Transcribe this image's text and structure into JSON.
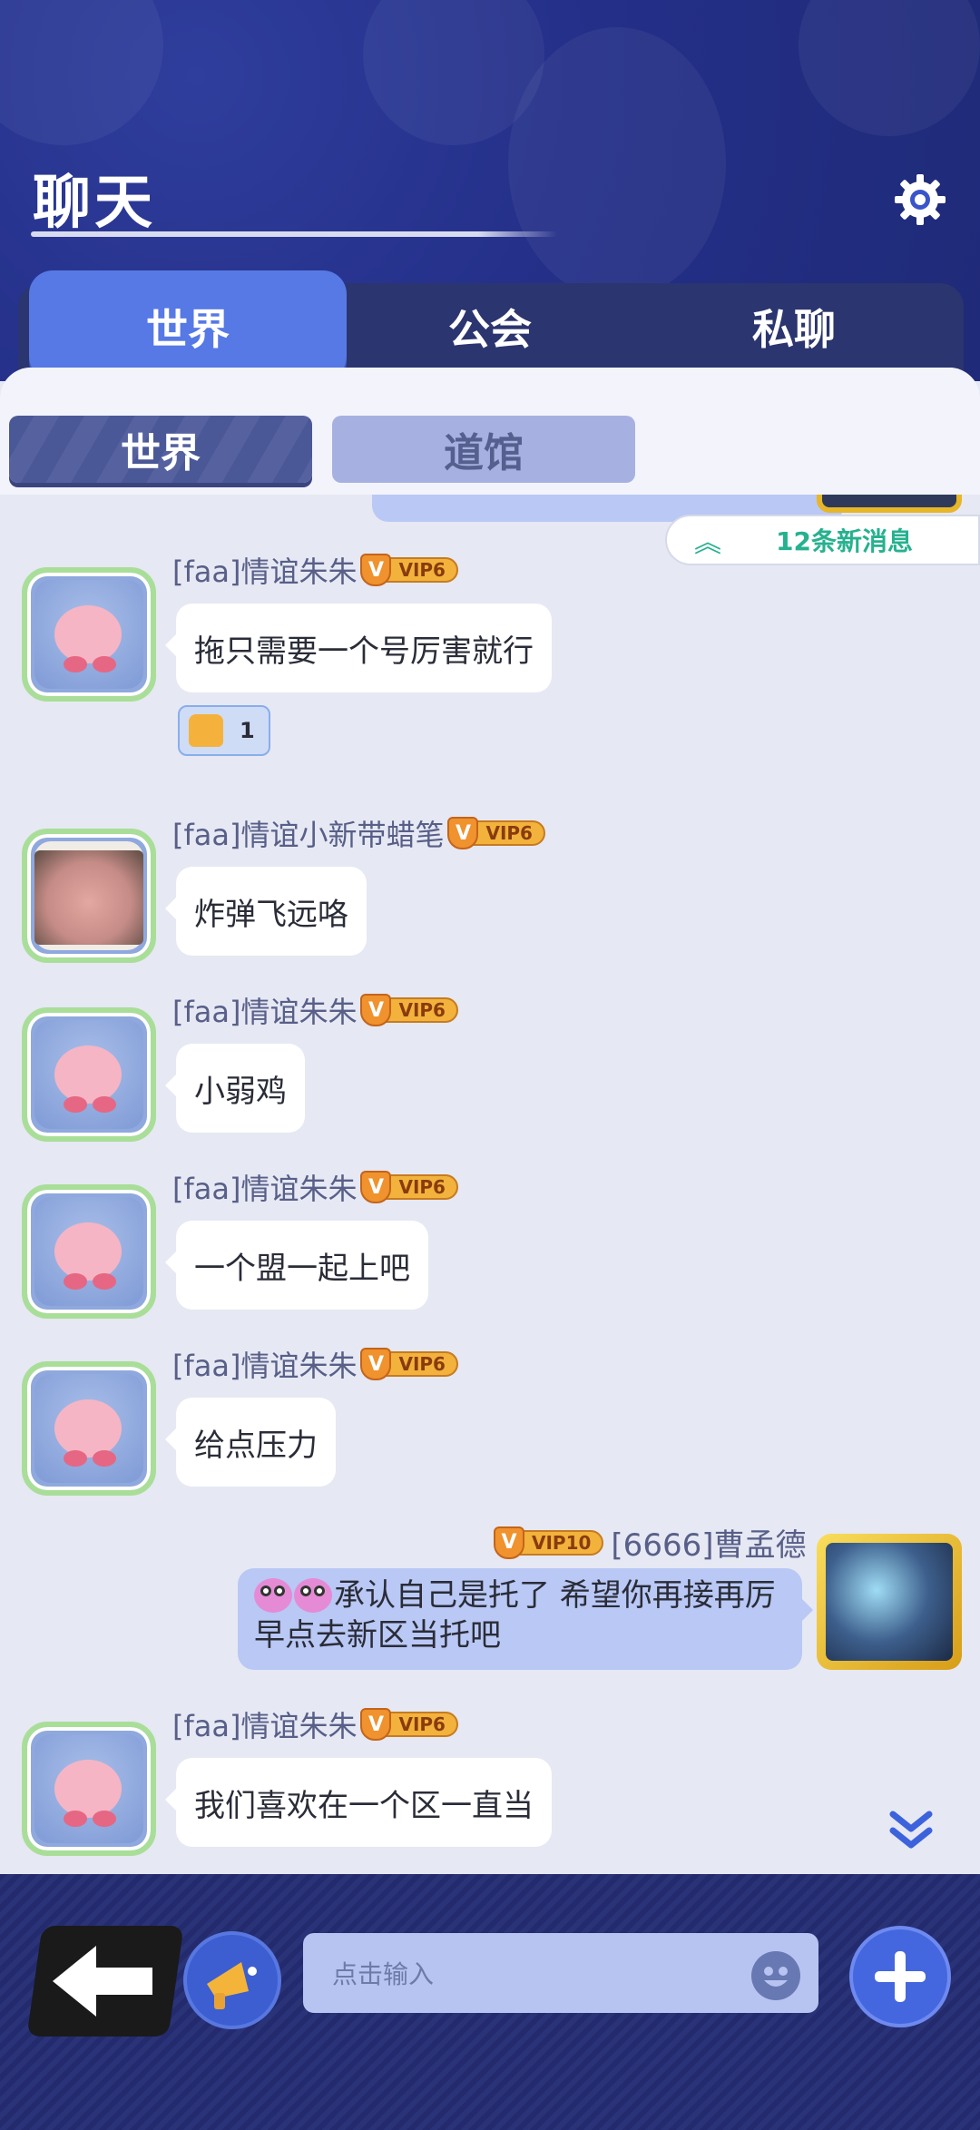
{
  "header": {
    "title": "聊天"
  },
  "tabs": [
    {
      "label": "世界",
      "active": true
    },
    {
      "label": "公会",
      "active": false
    },
    {
      "label": "私聊",
      "active": false
    }
  ],
  "subtabs": [
    {
      "label": "世界",
      "active": true
    },
    {
      "label": "道馆",
      "active": false
    }
  ],
  "new_messages": {
    "label": "12条新消息"
  },
  "messages": [
    {
      "name": "[faa]情谊朱朱",
      "vip": "VIP6",
      "text": "拖只需要一个号厉害就行",
      "likes": "1"
    },
    {
      "name": "[faa]情谊小新带蜡笔",
      "vip": "VIP6",
      "text": "炸弹飞远咯"
    },
    {
      "name": "[faa]情谊朱朱",
      "vip": "VIP6",
      "text": "小弱鸡"
    },
    {
      "name": "[faa]情谊朱朱",
      "vip": "VIP6",
      "text": "一个盟一起上吧"
    },
    {
      "name": "[faa]情谊朱朱",
      "vip": "VIP6",
      "text": "给点压力"
    },
    {
      "name": "[6666]曹孟德",
      "vip": "VIP10",
      "text": "承认自己是托了 希望你再接再厉 早点去新区当托吧"
    },
    {
      "name": "[faa]情谊朱朱",
      "vip": "VIP6",
      "text": "我们喜欢在一个区一直当"
    }
  ],
  "input": {
    "placeholder": "点击输入"
  },
  "icons": {
    "settings": "gear-icon",
    "back": "back-arrow-icon",
    "speaker": "megaphone-icon",
    "emoji": "smile-icon",
    "add": "plus-icon",
    "scroll": "double-chevron-down-icon"
  },
  "colors": {
    "accent": "#5779e5",
    "header_bg": "#243089",
    "chat_bg": "#e6e8f3",
    "new_msg_text": "#26b18f"
  }
}
